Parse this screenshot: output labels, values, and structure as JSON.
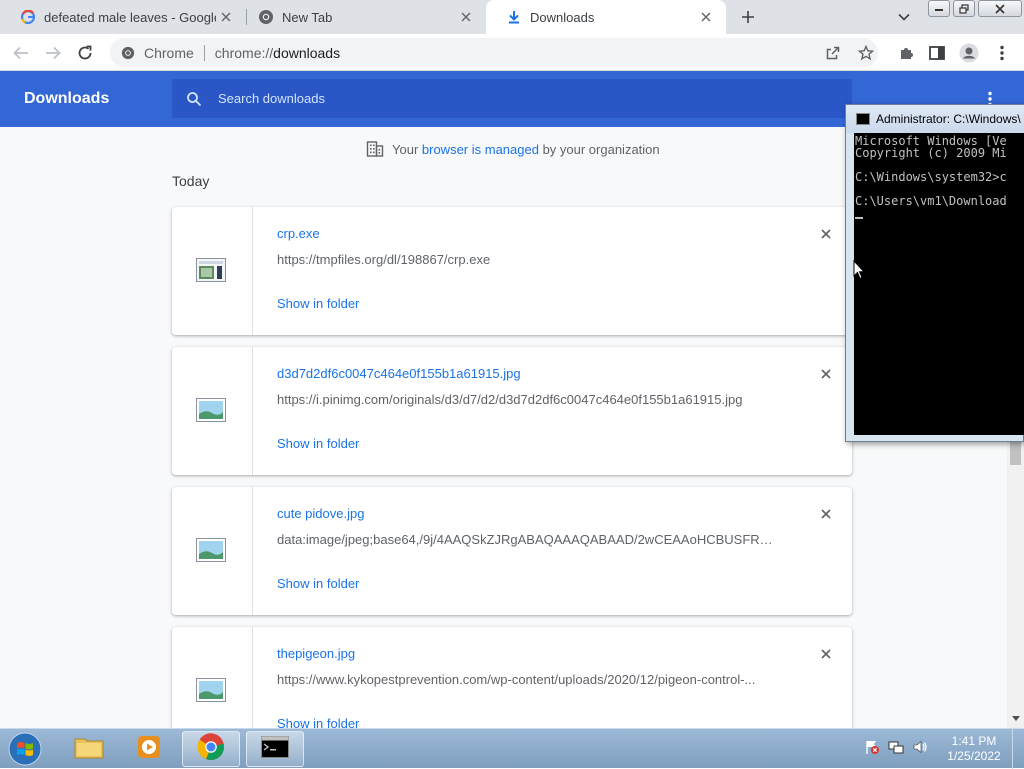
{
  "tabs": [
    {
      "title": "defeated male leaves - Google Se",
      "icon": "google-icon",
      "active": false
    },
    {
      "title": "New Tab",
      "icon": "chrome-icon",
      "active": false
    },
    {
      "title": "Downloads",
      "icon": "download-icon",
      "active": true
    }
  ],
  "omnibox": {
    "chip": "Chrome",
    "scheme": "chrome://",
    "host": "downloads"
  },
  "downloads": {
    "title": "Downloads",
    "search_placeholder": "Search downloads",
    "managed": {
      "prefix": "Your ",
      "link": "browser is managed",
      "suffix": " by your organization"
    },
    "section": "Today",
    "show_in_folder": "Show in folder",
    "items": [
      {
        "name": "crp.exe",
        "url": "https://tmpfiles.org/dl/198867/crp.exe",
        "type": "exe"
      },
      {
        "name": "d3d7d2df6c0047c464e0f155b1a61915.jpg",
        "url": "https://i.pinimg.com/originals/d3/d7/d2/d3d7d2df6c0047c464e0f155b1a61915.jpg",
        "type": "image"
      },
      {
        "name": "cute pidove.jpg",
        "url": "data:image/jpeg;base64,/9j/4AAQSkZJRgABAQAAAQABAAD/2wCEAAoHCBUSFRgR...",
        "type": "image"
      },
      {
        "name": "thepigeon.jpg",
        "url": "https://www.kykopestprevention.com/wp-content/uploads/2020/12/pigeon-control-...",
        "type": "image"
      }
    ]
  },
  "console": {
    "title": "Administrator: C:\\Windows\\",
    "lines": [
      "Microsoft Windows [Ve",
      "Copyright (c) 2009 Mi",
      "",
      "C:\\Windows\\system32>c",
      "",
      "C:\\Users\\vm1\\Download"
    ]
  },
  "taskbar": {
    "time": "1:41 PM",
    "date": "1/25/2022"
  },
  "colors": {
    "header_blue": "#3367d6",
    "link_blue": "#1a73e8"
  }
}
